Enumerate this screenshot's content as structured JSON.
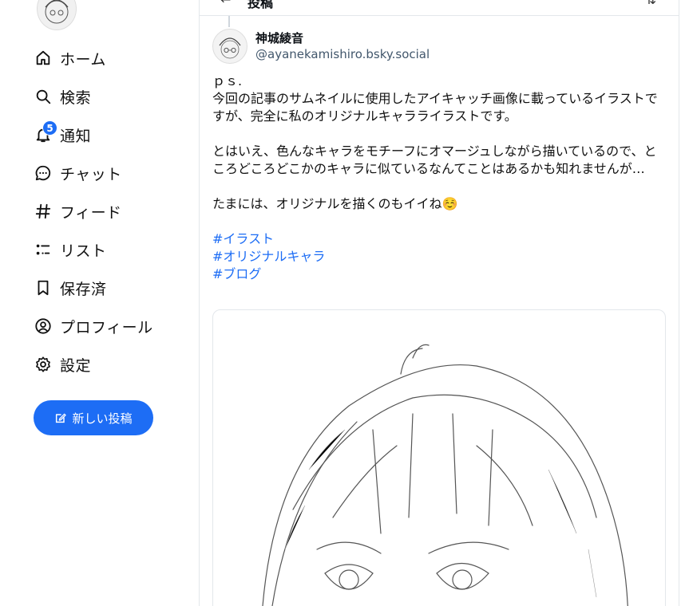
{
  "sidebar": {
    "items": [
      {
        "label": "ホーム",
        "icon": "home-icon"
      },
      {
        "label": "検索",
        "icon": "search-icon"
      },
      {
        "label": "通知",
        "icon": "bell-icon",
        "badge": "5"
      },
      {
        "label": "チャット",
        "icon": "chat-icon"
      },
      {
        "label": "フィード",
        "icon": "hash-icon"
      },
      {
        "label": "リスト",
        "icon": "list-icon"
      },
      {
        "label": "保存済",
        "icon": "bookmark-icon"
      },
      {
        "label": "プロフィール",
        "icon": "profile-icon"
      },
      {
        "label": "設定",
        "icon": "gear-icon"
      }
    ],
    "new_post_label": "新しい投稿"
  },
  "header": {
    "title": "投稿"
  },
  "post": {
    "author_name": "神城綾音",
    "author_handle": "@ayanekamishiro.bsky.social",
    "line1": "ｐｓ.",
    "para1": "今回の記事のサムネイルに使用したアイキャッチ画像に載っているイラストですが、完全に私のオリジナルキャラライラストです。",
    "para2": "とはいえ、色んなキャラをモチーフにオマージュしながら描いているので、ところどころどこかのキャラに似ているなんてことはあるかも知れませんが…",
    "para3": "たまには、オリジナルを描くのもイイね☺️",
    "tags": [
      "#イラスト",
      "#オリジナルキャラ",
      "#ブログ"
    ]
  },
  "colors": {
    "accent": "#1d6df5",
    "handle": "#42576c",
    "border": "#e3e7eb"
  }
}
